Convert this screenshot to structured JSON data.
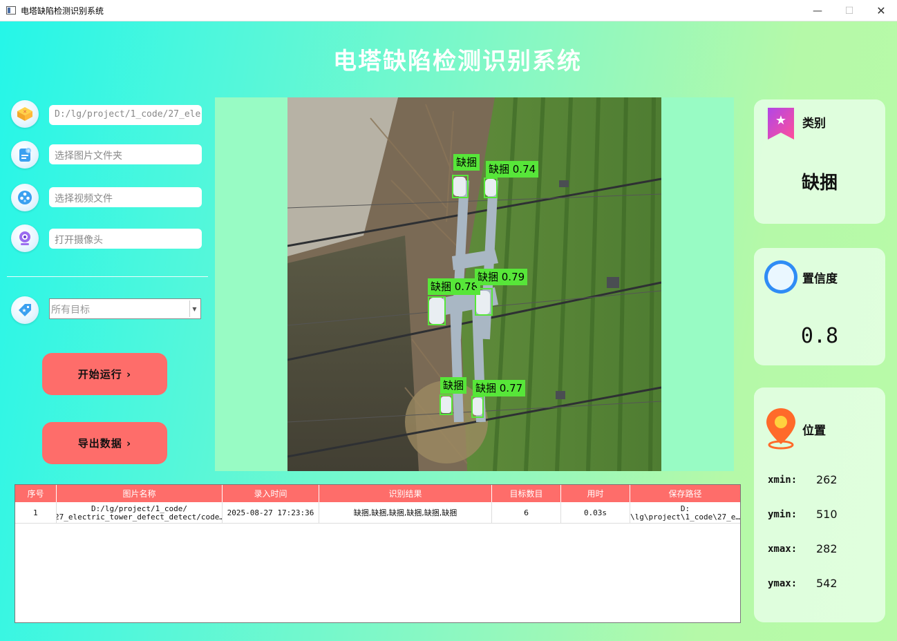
{
  "window": {
    "title": "电塔缺陷检测识别系统",
    "min_symbol": "—",
    "max_symbol": "☐",
    "close_symbol": "✕"
  },
  "header": {
    "title": "电塔缺陷检测识别系统"
  },
  "sidebar": {
    "file_path_value": "D:/lg/project/1_code/27_ele",
    "folder_placeholder": "选择图片文件夹",
    "video_placeholder": "选择视频文件",
    "camera_placeholder": "打开摄像头",
    "target_select_value": "所有目标",
    "start_button": "开始运行 ›",
    "export_button": "导出数据 ›"
  },
  "detections": [
    {
      "label": "缺捆"
    },
    {
      "label": "缺捆 0.74"
    },
    {
      "label": "缺捆 0.78"
    },
    {
      "label": "缺捆 0.79"
    },
    {
      "label": "缺捆"
    },
    {
      "label": "缺捆 0.77"
    }
  ],
  "cards": {
    "category": {
      "title": "类别",
      "value": "缺捆"
    },
    "confidence": {
      "title": "置信度",
      "value": "0.8"
    },
    "position": {
      "title": "位置",
      "xmin_label": "xmin:",
      "xmin": "262",
      "ymin_label": "ymin:",
      "ymin": "510",
      "xmax_label": "xmax:",
      "xmax": "282",
      "ymax_label": "ymax:",
      "ymax": "542"
    }
  },
  "table": {
    "headers": [
      "序号",
      "图片名称",
      "录入时间",
      "识别结果",
      "目标数目",
      "用时",
      "保存路径"
    ],
    "rows": [
      {
        "index": "1",
        "name_line1": "D:/lg/project/1_code/",
        "name_line2": "27_electric_tower_defect_detect/code…",
        "time": "2025-08-27 17:23:36",
        "result": "缺捆,缺捆,缺捆,缺捆,缺捆,缺捆",
        "count": "6",
        "duration": "0.03s",
        "path_line1": "D:",
        "path_line2": "\\lg\\project\\1_code\\27_e…"
      }
    ]
  },
  "colors": {
    "accent": "#fe6d6a",
    "detection": "#57e639"
  }
}
